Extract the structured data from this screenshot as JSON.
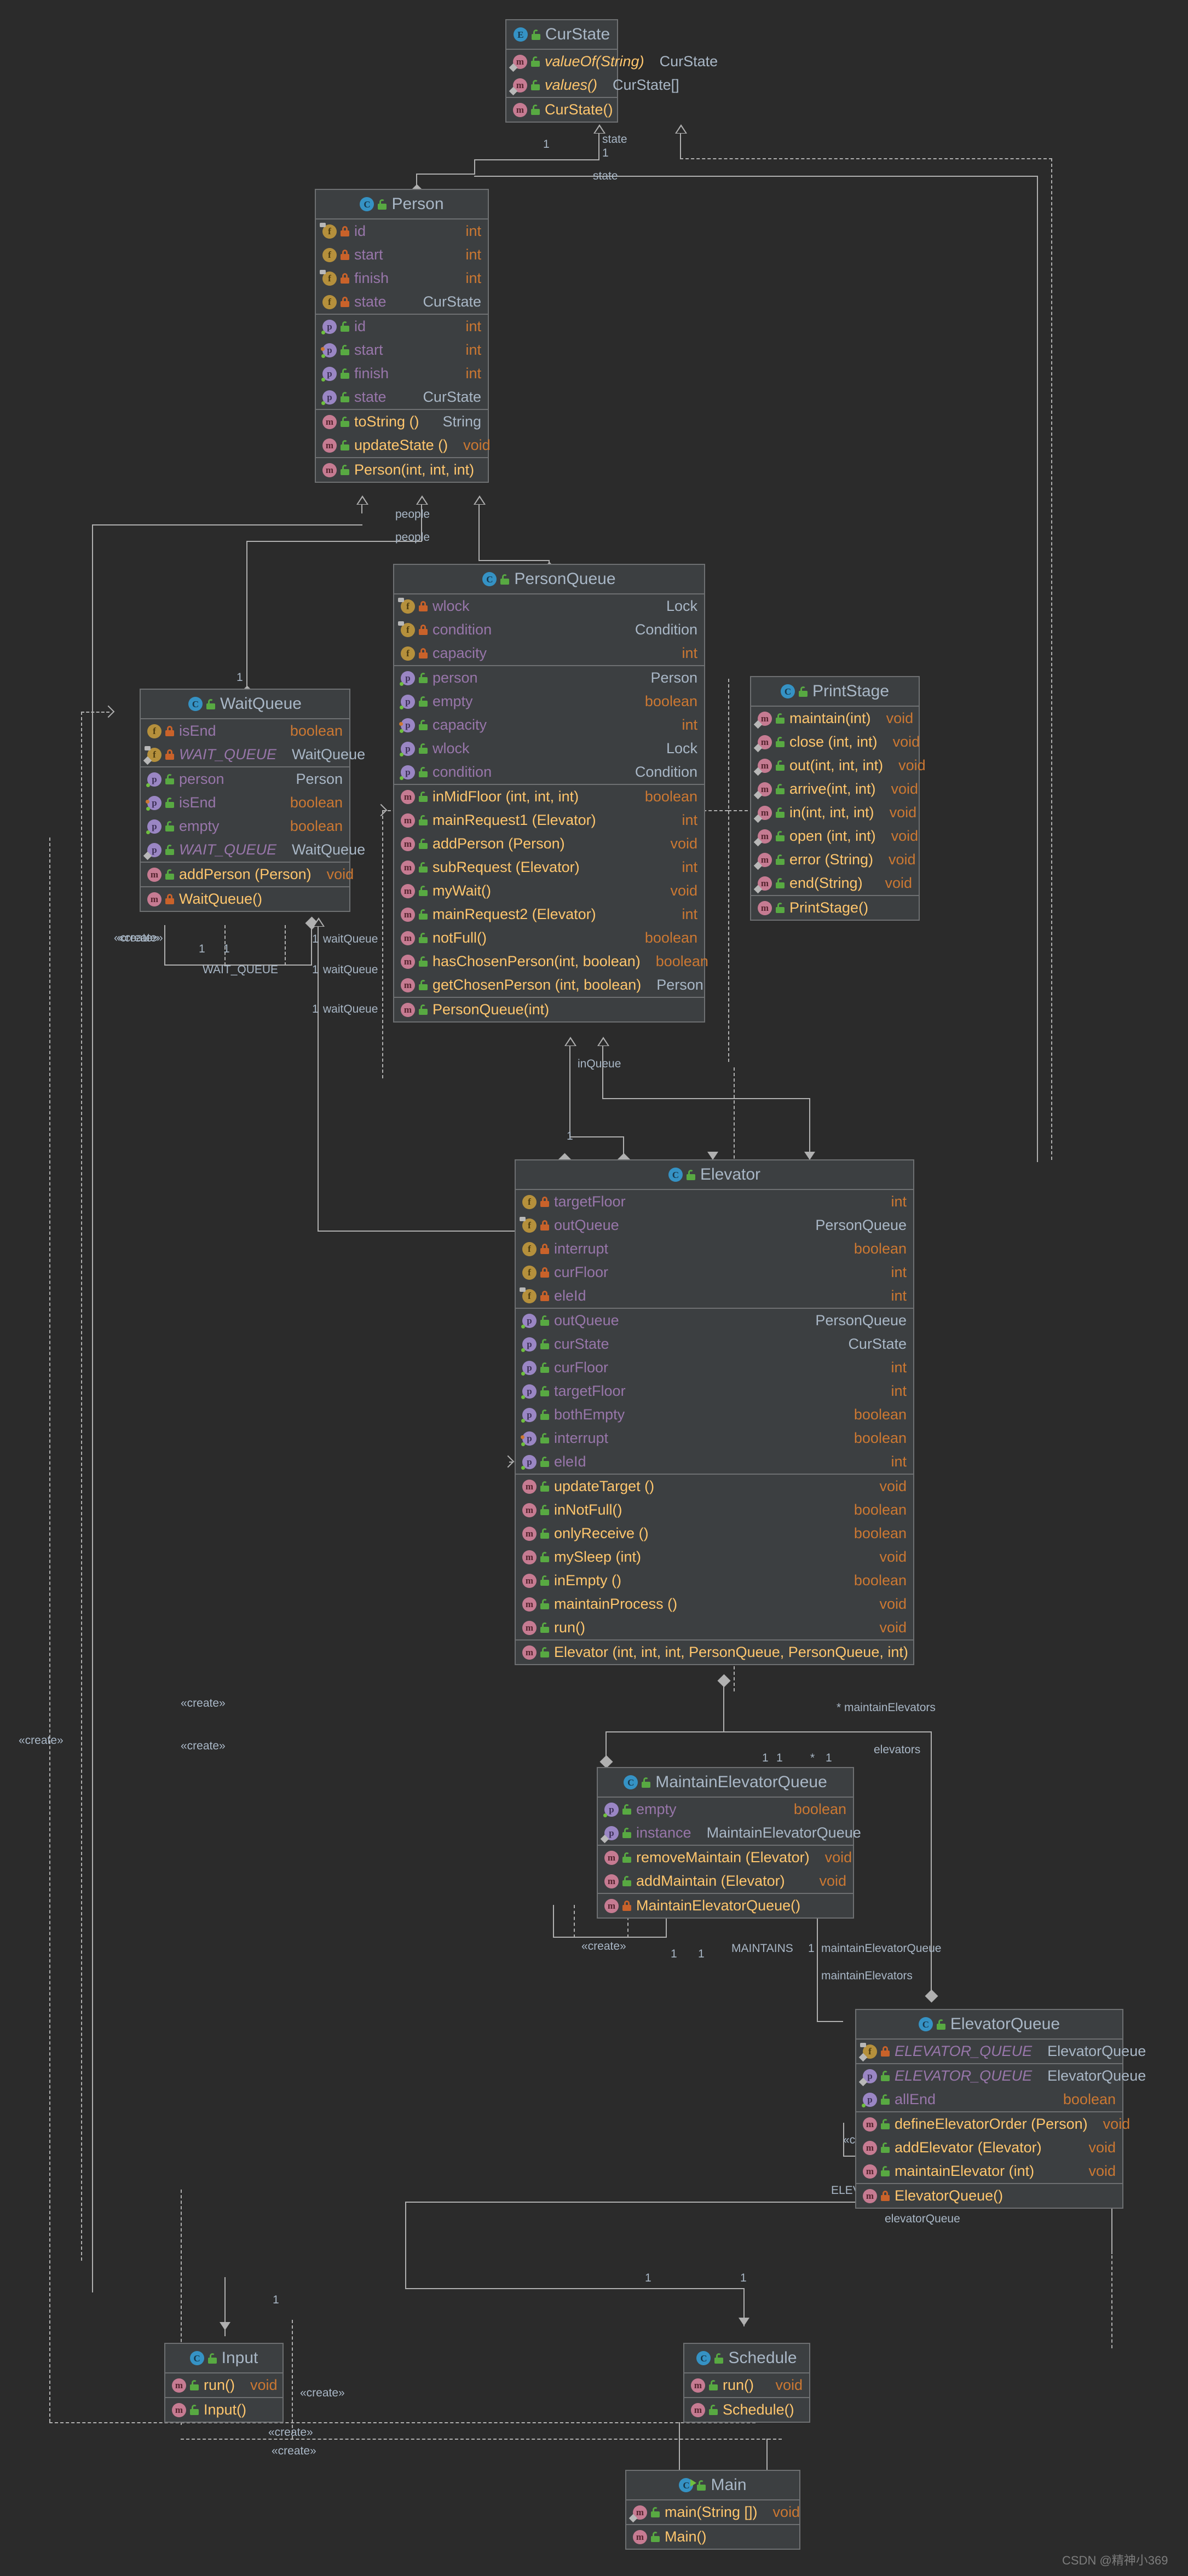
{
  "diagram": {
    "title": "UML class diagram",
    "watermark": "CSDN @精神小369",
    "colors": {
      "background": "#2b2b2b",
      "box_bg": "#3c3f41",
      "box_border": "#6e7072",
      "text": "#a9b7c6",
      "method": "#ffc66d",
      "field": "#9876aa",
      "primitive": "#cc7832",
      "line": "#b0b0b0"
    }
  },
  "classes": {
    "curstate": {
      "name": "CurState",
      "kind_icon": "enum-icon",
      "kind_glyph": "E",
      "visibility": "public",
      "members": [
        {
          "icon": "method-icon",
          "vis": "public",
          "name": "valueOf(String)",
          "type": "CurState",
          "static": true,
          "italic": true
        },
        {
          "icon": "method-icon",
          "vis": "public",
          "name": "values()",
          "type": "CurState[]",
          "static": true,
          "italic": true
        }
      ],
      "constructors": [
        {
          "icon": "method-icon",
          "vis": "public",
          "name": "CurState()",
          "type": ""
        }
      ]
    },
    "person": {
      "name": "Person",
      "kind_icon": "class-icon",
      "kind_glyph": "C",
      "visibility": "public",
      "fields": [
        {
          "icon": "field-icon",
          "vis": "private",
          "name": "id",
          "type": "int",
          "final": true
        },
        {
          "icon": "field-icon",
          "vis": "private",
          "name": "start",
          "type": "int"
        },
        {
          "icon": "field-icon",
          "vis": "private",
          "name": "finish",
          "type": "int",
          "final": true
        },
        {
          "icon": "field-icon",
          "vis": "private",
          "name": "state",
          "type": "CurState"
        }
      ],
      "properties": [
        {
          "icon": "property-icon",
          "vis": "public",
          "name": "id",
          "type": "int"
        },
        {
          "icon": "property-icon",
          "vis": "public",
          "name": "start",
          "type": "int"
        },
        {
          "icon": "property-icon",
          "vis": "public",
          "name": "finish",
          "type": "int"
        },
        {
          "icon": "property-icon",
          "vis": "public",
          "name": "state",
          "type": "CurState"
        }
      ],
      "methods": [
        {
          "icon": "method-icon",
          "vis": "public",
          "name": "toString ()",
          "type": "String"
        },
        {
          "icon": "method-icon",
          "vis": "public",
          "name": "updateState ()",
          "type": "void"
        }
      ],
      "constructors": [
        {
          "icon": "method-icon",
          "vis": "public",
          "name": "Person(int, int, int)",
          "type": ""
        }
      ]
    },
    "personqueue": {
      "name": "PersonQueue",
      "kind_icon": "class-icon",
      "kind_glyph": "C",
      "visibility": "public",
      "fields": [
        {
          "icon": "field-icon",
          "vis": "private",
          "name": "wlock",
          "type": "Lock",
          "final": true
        },
        {
          "icon": "field-icon",
          "vis": "private",
          "name": "condition",
          "type": "Condition",
          "final": true
        },
        {
          "icon": "field-icon",
          "vis": "private",
          "name": "capacity",
          "type": "int"
        }
      ],
      "properties": [
        {
          "icon": "property-icon",
          "vis": "public",
          "name": "person",
          "type": "Person"
        },
        {
          "icon": "property-icon",
          "vis": "public",
          "name": "empty",
          "type": "boolean"
        },
        {
          "icon": "property-icon",
          "vis": "public",
          "name": "capacity",
          "type": "int"
        },
        {
          "icon": "property-icon",
          "vis": "public",
          "name": "wlock",
          "type": "Lock"
        },
        {
          "icon": "property-icon",
          "vis": "public",
          "name": "condition",
          "type": "Condition"
        }
      ],
      "methods": [
        {
          "icon": "method-icon",
          "vis": "public",
          "name": "inMidFloor (int, int, int)",
          "type": "boolean"
        },
        {
          "icon": "method-icon",
          "vis": "public",
          "name": "mainRequest1 (Elevator)",
          "type": "int"
        },
        {
          "icon": "method-icon",
          "vis": "public",
          "name": "addPerson (Person)",
          "type": "void"
        },
        {
          "icon": "method-icon",
          "vis": "public",
          "name": "subRequest (Elevator)",
          "type": "int"
        },
        {
          "icon": "method-icon",
          "vis": "public",
          "name": "myWait()",
          "type": "void"
        },
        {
          "icon": "method-icon",
          "vis": "public",
          "name": "mainRequest2 (Elevator)",
          "type": "int"
        },
        {
          "icon": "method-icon",
          "vis": "public",
          "name": "notFull()",
          "type": "boolean"
        },
        {
          "icon": "method-icon",
          "vis": "public",
          "name": "hasChosenPerson(int, boolean)",
          "type": "boolean"
        },
        {
          "icon": "method-icon",
          "vis": "public",
          "name": "getChosenPerson (int, boolean)",
          "type": "Person"
        }
      ],
      "constructors": [
        {
          "icon": "method-icon",
          "vis": "public",
          "name": "PersonQueue(int)",
          "type": ""
        }
      ]
    },
    "waitqueue": {
      "name": "WaitQueue",
      "kind_icon": "class-icon",
      "kind_glyph": "C",
      "visibility": "public",
      "fields": [
        {
          "icon": "field-icon",
          "vis": "private",
          "name": "isEnd",
          "type": "boolean"
        },
        {
          "icon": "field-icon",
          "vis": "private",
          "name": "WAIT_QUEUE",
          "type": "WaitQueue",
          "static": true,
          "italic": true
        }
      ],
      "properties": [
        {
          "icon": "property-icon",
          "vis": "public",
          "name": "person",
          "type": "Person"
        },
        {
          "icon": "property-icon",
          "vis": "public",
          "name": "isEnd",
          "type": "boolean"
        },
        {
          "icon": "property-icon",
          "vis": "public",
          "name": "empty",
          "type": "boolean"
        },
        {
          "icon": "property-icon",
          "vis": "public",
          "name": "WAIT_QUEUE",
          "type": "WaitQueue",
          "static": true,
          "italic": true
        }
      ],
      "methods": [
        {
          "icon": "method-icon",
          "vis": "public",
          "name": "addPerson (Person)",
          "type": "void"
        }
      ],
      "constructors": [
        {
          "icon": "method-icon",
          "vis": "private",
          "name": "WaitQueue()",
          "type": ""
        }
      ]
    },
    "printstage": {
      "name": "PrintStage",
      "kind_icon": "class-icon",
      "kind_glyph": "C",
      "visibility": "public",
      "methods": [
        {
          "icon": "method-icon",
          "vis": "public",
          "name": "maintain(int)",
          "type": "void",
          "static": true
        },
        {
          "icon": "method-icon",
          "vis": "public",
          "name": "close (int, int)",
          "type": "void",
          "static": true
        },
        {
          "icon": "method-icon",
          "vis": "public",
          "name": "out(int, int, int)",
          "type": "void",
          "static": true
        },
        {
          "icon": "method-icon",
          "vis": "public",
          "name": "arrive(int, int)",
          "type": "void",
          "static": true
        },
        {
          "icon": "method-icon",
          "vis": "public",
          "name": "in(int, int, int)",
          "type": "void",
          "static": true
        },
        {
          "icon": "method-icon",
          "vis": "public",
          "name": "open (int, int)",
          "type": "void",
          "static": true
        },
        {
          "icon": "method-icon",
          "vis": "public",
          "name": "error (String)",
          "type": "void",
          "static": true
        },
        {
          "icon": "method-icon",
          "vis": "public",
          "name": "end(String)",
          "type": "void",
          "static": true
        }
      ],
      "constructors": [
        {
          "icon": "method-icon",
          "vis": "public",
          "name": "PrintStage()",
          "type": ""
        }
      ]
    },
    "elevator": {
      "name": "Elevator",
      "kind_icon": "class-icon",
      "kind_glyph": "C",
      "visibility": "public",
      "fields": [
        {
          "icon": "field-icon",
          "vis": "private",
          "name": "targetFloor",
          "type": "int"
        },
        {
          "icon": "field-icon",
          "vis": "private",
          "name": "outQueue",
          "type": "PersonQueue",
          "final": true
        },
        {
          "icon": "field-icon",
          "vis": "private",
          "name": "interrupt",
          "type": "boolean"
        },
        {
          "icon": "field-icon",
          "vis": "private",
          "name": "curFloor",
          "type": "int"
        },
        {
          "icon": "field-icon",
          "vis": "private",
          "name": "eleId",
          "type": "int",
          "final": true
        }
      ],
      "properties": [
        {
          "icon": "property-icon",
          "vis": "public",
          "name": "outQueue",
          "type": "PersonQueue"
        },
        {
          "icon": "property-icon",
          "vis": "public",
          "name": "curState",
          "type": "CurState"
        },
        {
          "icon": "property-icon",
          "vis": "public",
          "name": "curFloor",
          "type": "int"
        },
        {
          "icon": "property-icon",
          "vis": "public",
          "name": "targetFloor",
          "type": "int"
        },
        {
          "icon": "property-icon",
          "vis": "public",
          "name": "bothEmpty",
          "type": "boolean"
        },
        {
          "icon": "property-icon",
          "vis": "public",
          "name": "interrupt",
          "type": "boolean"
        },
        {
          "icon": "property-icon",
          "vis": "public",
          "name": "eleId",
          "type": "int"
        }
      ],
      "methods": [
        {
          "icon": "method-icon",
          "vis": "public",
          "name": "updateTarget ()",
          "type": "void"
        },
        {
          "icon": "method-icon",
          "vis": "public",
          "name": "inNotFull()",
          "type": "boolean"
        },
        {
          "icon": "method-icon",
          "vis": "public",
          "name": "onlyReceive ()",
          "type": "boolean"
        },
        {
          "icon": "method-icon",
          "vis": "public",
          "name": "mySleep (int)",
          "type": "void"
        },
        {
          "icon": "method-icon",
          "vis": "public",
          "name": "inEmpty ()",
          "type": "boolean"
        },
        {
          "icon": "method-icon",
          "vis": "public",
          "name": "maintainProcess ()",
          "type": "void"
        },
        {
          "icon": "method-icon",
          "vis": "public",
          "name": "run()",
          "type": "void"
        }
      ],
      "constructors": [
        {
          "icon": "method-icon",
          "vis": "public",
          "name": "Elevator (int, int, int, PersonQueue, PersonQueue, int)",
          "type": ""
        }
      ]
    },
    "maintainelevatorqueue": {
      "name": "MaintainElevatorQueue",
      "kind_icon": "class-icon",
      "kind_glyph": "C",
      "visibility": "public",
      "properties": [
        {
          "icon": "property-icon",
          "vis": "public",
          "name": "empty",
          "type": "boolean"
        },
        {
          "icon": "property-icon",
          "vis": "public",
          "name": "instance",
          "type": "MaintainElevatorQueue",
          "static": true
        }
      ],
      "methods": [
        {
          "icon": "method-icon",
          "vis": "public",
          "name": "removeMaintain (Elevator)",
          "type": "void"
        },
        {
          "icon": "method-icon",
          "vis": "public",
          "name": "addMaintain (Elevator)",
          "type": "void"
        }
      ],
      "constructors": [
        {
          "icon": "method-icon",
          "vis": "private",
          "name": "MaintainElevatorQueue()",
          "type": ""
        }
      ]
    },
    "elevatorqueue": {
      "name": "ElevatorQueue",
      "kind_icon": "class-icon",
      "kind_glyph": "C",
      "visibility": "public",
      "fields": [
        {
          "icon": "field-icon",
          "vis": "private",
          "name": "ELEVATOR_QUEUE",
          "type": "ElevatorQueue",
          "static": true,
          "italic": true
        }
      ],
      "properties": [
        {
          "icon": "property-icon",
          "vis": "public",
          "name": "ELEVATOR_QUEUE",
          "type": "ElevatorQueue",
          "static": true,
          "italic": true
        },
        {
          "icon": "property-icon",
          "vis": "public",
          "name": "allEnd",
          "type": "boolean"
        }
      ],
      "methods": [
        {
          "icon": "method-icon",
          "vis": "public",
          "name": "defineElevatorOrder (Person)",
          "type": "void"
        },
        {
          "icon": "method-icon",
          "vis": "public",
          "name": "addElevator (Elevator)",
          "type": "void"
        },
        {
          "icon": "method-icon",
          "vis": "public",
          "name": "maintainElevator (int)",
          "type": "void"
        }
      ],
      "constructors": [
        {
          "icon": "method-icon",
          "vis": "private",
          "name": "ElevatorQueue()",
          "type": ""
        }
      ]
    },
    "input": {
      "name": "Input",
      "kind_icon": "class-icon",
      "kind_glyph": "C",
      "visibility": "public",
      "methods": [
        {
          "icon": "method-icon",
          "vis": "public",
          "name": "run()",
          "type": "void"
        }
      ],
      "constructors": [
        {
          "icon": "method-icon",
          "vis": "public",
          "name": "Input()",
          "type": ""
        }
      ]
    },
    "schedule": {
      "name": "Schedule",
      "kind_icon": "class-icon",
      "kind_glyph": "C",
      "visibility": "public",
      "methods": [
        {
          "icon": "method-icon",
          "vis": "public",
          "name": "run()",
          "type": "void"
        }
      ],
      "constructors": [
        {
          "icon": "method-icon",
          "vis": "public",
          "name": "Schedule()",
          "type": ""
        }
      ]
    },
    "main": {
      "name": "Main",
      "kind_icon": "runnable-class-icon",
      "kind_glyph": "C",
      "visibility": "public",
      "methods": [
        {
          "icon": "method-icon",
          "vis": "public",
          "name": "main(String [])",
          "type": "void",
          "static": true
        }
      ],
      "constructors": [
        {
          "icon": "method-icon",
          "vis": "public",
          "name": "Main()",
          "type": ""
        }
      ]
    }
  },
  "relationships": {
    "labels": [
      {
        "id": "state1",
        "text": "state"
      },
      {
        "id": "state2",
        "text": "state"
      },
      {
        "id": "people1",
        "text": "people"
      },
      {
        "id": "people2",
        "text": "people"
      },
      {
        "id": "waitqueue1",
        "text": "waitQueue"
      },
      {
        "id": "waitqueue2",
        "text": "waitQueue"
      },
      {
        "id": "waitqueue3",
        "text": "waitQueue"
      },
      {
        "id": "wait_queue_const",
        "text": "WAIT_QUEUE"
      },
      {
        "id": "inqueue",
        "text": "inQueue"
      },
      {
        "id": "maintainelevators1",
        "text": "maintainElevators"
      },
      {
        "id": "maintainelevators2",
        "text": "maintainElevators"
      },
      {
        "id": "maintainelevators3",
        "text": "maintainElevators"
      },
      {
        "id": "elevators",
        "text": "elevators"
      },
      {
        "id": "maintains",
        "text": "MAINTAINS"
      },
      {
        "id": "maintainelevatorqueue",
        "text": "maintainElevatorQueue"
      },
      {
        "id": "elevator_queue_const",
        "text": "ELEVATOR_QUEUE"
      },
      {
        "id": "elevatorqueue1",
        "text": "elevatorQueue"
      },
      {
        "id": "elevatorqueue2",
        "text": "elevatorQueue"
      },
      {
        "id": "create1",
        "text": "«create»"
      },
      {
        "id": "create2",
        "text": "«create»"
      },
      {
        "id": "create3",
        "text": "«create»"
      },
      {
        "id": "create4",
        "text": "«create»"
      },
      {
        "id": "create5",
        "text": "«create»"
      },
      {
        "id": "create6",
        "text": "«create»"
      },
      {
        "id": "create7",
        "text": "«create»"
      },
      {
        "id": "create8",
        "text": "«create»"
      },
      {
        "id": "create9",
        "text": "«create»"
      }
    ],
    "multiplicities": [
      "1",
      "*"
    ]
  }
}
